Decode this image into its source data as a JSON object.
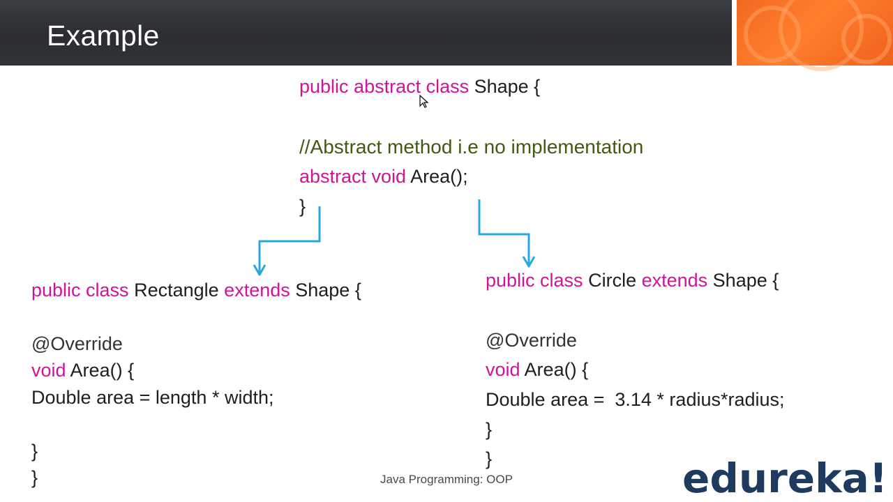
{
  "slide": {
    "title": "Example",
    "footer": "Java Programming: OOP",
    "logo": "edureka!"
  },
  "shape_class": {
    "line1_kw": "public abstract class ",
    "line1_rest": "Shape {",
    "comment": "//Abstract method i.e no implementation",
    "line3_kw": "abstract void ",
    "line3_rest": "Area();",
    "close": "}"
  },
  "rectangle_class": {
    "decl_kw1": "public class ",
    "decl_name": "Rectangle ",
    "decl_kw2": "extends ",
    "decl_rest": "Shape {",
    "annotation": "@Override",
    "method_kw": "void ",
    "method_rest": "Area() {",
    "body": "Double area = length * width;",
    "close_method": "}",
    "close_class": "}"
  },
  "circle_class": {
    "decl_kw1": "public class ",
    "decl_name": "Circle ",
    "decl_kw2": "extends ",
    "decl_rest": "Shape {",
    "annotation": "@Override",
    "method_kw": "void ",
    "method_rest": "Area() {",
    "body": "Double area =  3.14 * radius*radius;",
    "close_method": "}",
    "close_class": "}"
  },
  "colors": {
    "keyword": "#d0139a",
    "comment": "#3f5a12",
    "arrow": "#29a8e0",
    "header_bg": "#2f3136",
    "accent_orange": "#f36a1f",
    "logo": "#1e3a5f"
  },
  "icons": [
    "mouse-cursor-icon",
    "arrow-down-left-icon",
    "arrow-down-right-icon"
  ]
}
